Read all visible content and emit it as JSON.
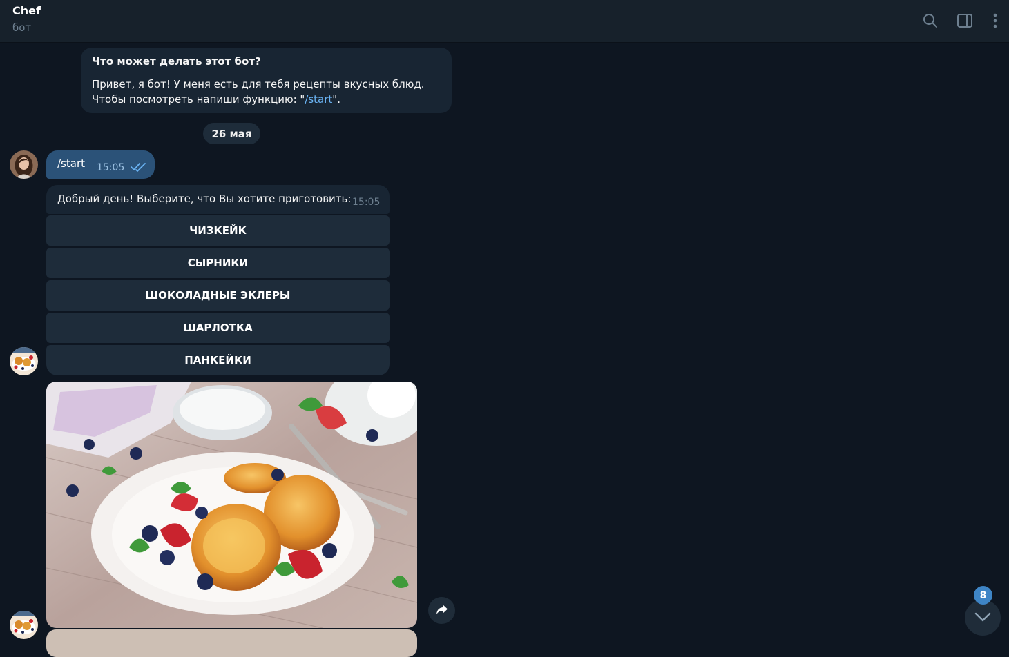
{
  "colors": {
    "background": "#0e1621",
    "header": "#17212b",
    "incoming_bubble": "#182533",
    "outgoing_bubble": "#2b5278",
    "link": "#6ab3f3",
    "unread_badge": "#3e85c6"
  },
  "header": {
    "title": "Chef",
    "subtitle": "бот",
    "icons": [
      "search-icon",
      "sidebar-toggle-icon",
      "more-vertical-icon"
    ]
  },
  "bot_info": {
    "title": "Что может делать этот бот?",
    "line1": "Привет, я бот! У меня есть для тебя рецепты вкусных блюд.",
    "line2_prefix": "Чтобы посмотреть напиши функцию: \"",
    "line2_link": "/start",
    "line2_suffix": "\"."
  },
  "date_separator": "26 мая",
  "messages": {
    "outgoing": {
      "text": "/start",
      "time": "15:05",
      "status": "double-check-icon"
    },
    "incoming": {
      "text": "Добрый день! Выберите, что Вы хотите приготовить:",
      "time": "15:05"
    }
  },
  "keyboard": [
    "ЧИЗКЕЙК",
    "СЫРНИКИ",
    "ШОКОЛАДНЫЕ ЭКЛЕРЫ",
    "ШАРЛОТКА",
    "ПАНКЕЙКИ"
  ],
  "photo": {
    "icon": "syrniki-photo"
  },
  "forward_button": {
    "icon": "forward-arrow-icon"
  },
  "scroll_down": {
    "icon": "chevron-down-icon",
    "unread_count": "8"
  }
}
